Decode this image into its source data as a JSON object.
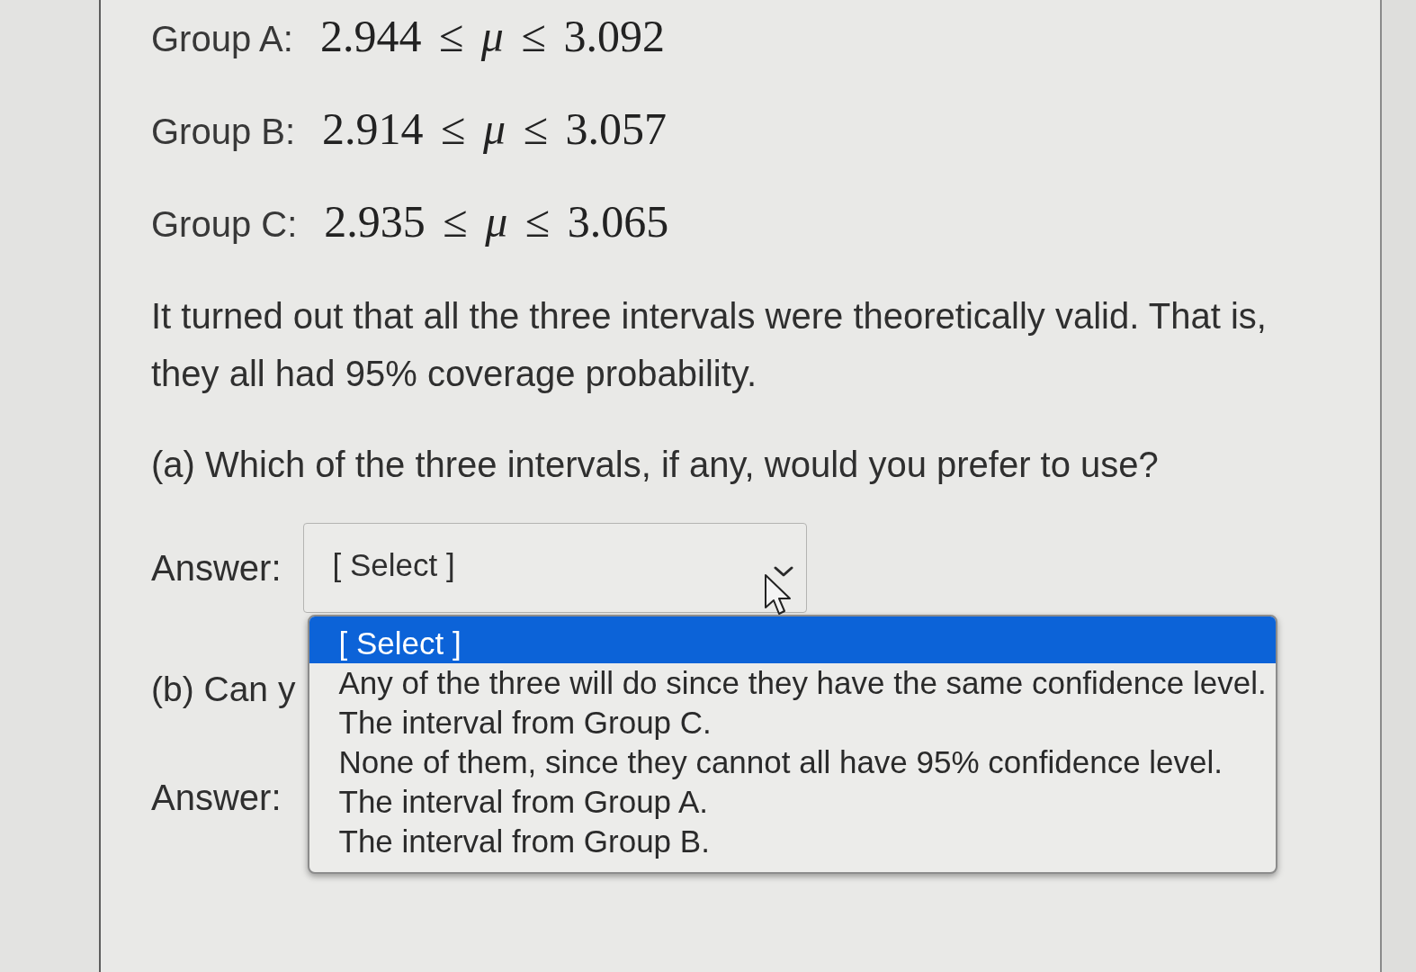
{
  "intervals": [
    {
      "label": "Group A:",
      "interval": "2.944 ≤ *μ* ≤ 3.092"
    },
    {
      "label": "Group B:",
      "interval": "2.914 ≤ *μ* ≤ 3.057"
    },
    {
      "label": "Group C:",
      "interval": "2.935 ≤ *μ* ≤ 3.065"
    }
  ],
  "statement": "It turned out that all the three intervals were theoretically valid. That is, they all had 95% coverage probability.",
  "question_a": {
    "text": "(a) Which of the three intervals, if any, would you prefer to use?",
    "answer_label": "Answer:",
    "select": {
      "value": "[ Select ]",
      "expanded": true,
      "options": [
        {
          "text": "[ Select ]",
          "selected": true
        },
        {
          "text": "Any of the three will do since they have the same confidence level.",
          "selected": false
        },
        {
          "text": "The interval from Group C.",
          "selected": false
        },
        {
          "text": "None of them, since they cannot all have 95% confidence level.",
          "selected": false
        },
        {
          "text": "The interval from Group A.",
          "selected": false
        },
        {
          "text": "The interval from Group B.",
          "selected": false
        }
      ]
    }
  },
  "question_b": {
    "text": "(b) Can y",
    "answer_label": "Answer:"
  }
}
